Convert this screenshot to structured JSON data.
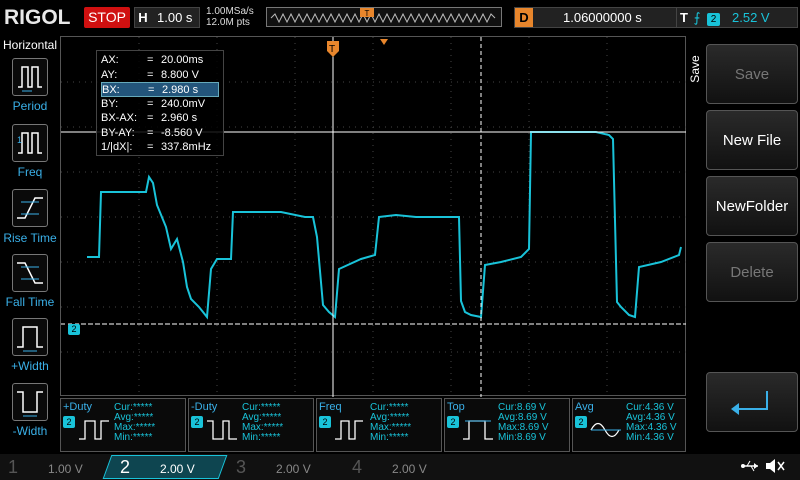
{
  "topbar": {
    "brand": "RIGOL",
    "run_status": "STOP",
    "timebase_key": "H",
    "timebase_value": "1.00 s",
    "sample_rate": "1.00MSa/s",
    "memory_depth": "12.0M pts",
    "delay_key": "D",
    "delay_value": "1.06000000 s",
    "trigger_key": "T",
    "trigger_slope": "⨍",
    "trigger_channel": "2",
    "trigger_level": "2.52 V"
  },
  "left_menu": {
    "title": "Horizontal",
    "items": [
      {
        "label": "Period"
      },
      {
        "label": "Freq"
      },
      {
        "label": "Rise Time"
      },
      {
        "label": "Fall Time"
      },
      {
        "label": "+Width"
      },
      {
        "label": "-Width"
      }
    ]
  },
  "cursor_info": {
    "rows": [
      {
        "name": "AX:",
        "eq": "=",
        "value": "20.00ms"
      },
      {
        "name": "AY:",
        "eq": "=",
        "value": "8.800 V"
      },
      {
        "name": "BX:",
        "eq": "=",
        "value": "2.980 s"
      },
      {
        "name": "BY:",
        "eq": "=",
        "value": "240.0mV"
      },
      {
        "name": "BX-AX:",
        "eq": "=",
        "value": "2.960 s"
      },
      {
        "name": "BY-AY:",
        "eq": "=",
        "value": "-8.560 V"
      },
      {
        "name": "1/|dX|:",
        "eq": "=",
        "value": "337.8mHz"
      }
    ]
  },
  "right_menu": {
    "section": "Save",
    "buttons": [
      {
        "label": "Save",
        "disabled": true
      },
      {
        "label": "New File",
        "disabled": false
      },
      {
        "label": "NewFolder",
        "disabled": false
      },
      {
        "label": "Delete",
        "disabled": true
      }
    ]
  },
  "measurements": [
    {
      "title": "+Duty",
      "channel": "2",
      "cur": "Cur:*****",
      "avg": "Avg:*****",
      "max": "Max:*****",
      "min": "Min:*****"
    },
    {
      "title": "-Duty",
      "channel": "2",
      "cur": "Cur:*****",
      "avg": "Avg:*****",
      "max": "Max:*****",
      "min": "Min:*****"
    },
    {
      "title": "Freq",
      "channel": "2",
      "cur": "Cur:*****",
      "avg": "Avg:*****",
      "max": "Max:*****",
      "min": "Min:*****"
    },
    {
      "title": "Top",
      "channel": "2",
      "cur": "Cur:8.69 V",
      "avg": "Avg:8.69 V",
      "max": "Max:8.69 V",
      "min": "Min:8.69 V"
    },
    {
      "title": "Avg",
      "channel": "2",
      "cur": "Cur:4.36 V",
      "avg": "Avg:4.36 V",
      "max": "Max:4.36 V",
      "min": "Min:4.36 V"
    }
  ],
  "channels": [
    {
      "num": "1",
      "scale": "1.00 V",
      "active": false
    },
    {
      "num": "2",
      "scale": "2.00 V",
      "active": true
    },
    {
      "num": "3",
      "scale": "2.00 V",
      "active": false
    },
    {
      "num": "4",
      "scale": "2.00 V",
      "active": false
    }
  ],
  "markers": {
    "trigger_marker": "T",
    "channel2_marker": "2"
  },
  "colors": {
    "channel2": "#19c3d9",
    "stop": "#d01010",
    "delay": "#e8862c",
    "trigger": "#e8862c"
  }
}
